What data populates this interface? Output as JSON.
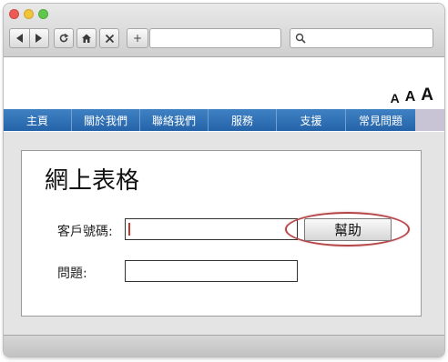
{
  "toolbar": {
    "new_tab_label": "+"
  },
  "font_size_controls": [
    "A",
    "A",
    "A"
  ],
  "nav": {
    "items": [
      "主頁",
      "關於我們",
      "聯絡我們",
      "服務",
      "支援",
      "常見問題"
    ]
  },
  "form": {
    "title": "網上表格",
    "customer_label": "客戶號碼:",
    "customer_value": "",
    "help_label": "幫助",
    "question_label": "問題:",
    "question_value": ""
  },
  "colors": {
    "nav_bar": "#2f6fb5",
    "highlight_ellipse": "#b4464a"
  }
}
